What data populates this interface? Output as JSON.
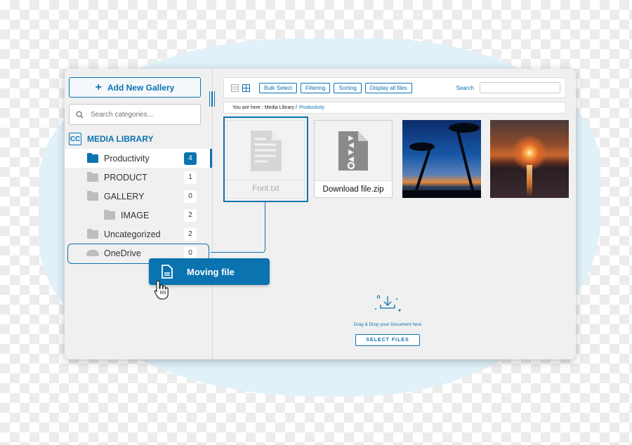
{
  "sidebar": {
    "add_gallery_label": "Add New Gallery",
    "search_placeholder": "Search categories...",
    "library_title": "MEDIA LIBRARY",
    "items": [
      {
        "label": "Productivity",
        "count": "4",
        "active": true,
        "icon": "folder-icon"
      },
      {
        "label": "PRODUCT",
        "count": "1",
        "icon": "folder-icon"
      },
      {
        "label": "GALLERY",
        "count": "0",
        "icon": "folder-icon"
      },
      {
        "label": "IMAGE",
        "count": "2",
        "icon": "folder-icon",
        "indent": 1
      },
      {
        "label": "Uncategorized",
        "count": "2",
        "icon": "folder-icon"
      },
      {
        "label": "OneDrive",
        "count": "0",
        "icon": "cloud-icon",
        "drop_target": true
      }
    ]
  },
  "toolbar": {
    "buttons": [
      "Bulk Select",
      "Filtering",
      "Sorting",
      "Display all files"
    ],
    "search_label": "Search",
    "search_value": ""
  },
  "breadcrumb": {
    "prefix": "You are here :",
    "path": "Media Library /",
    "current": "Productivity"
  },
  "files": [
    {
      "name": "Font.txt",
      "type": "text-file-icon",
      "selected": true
    },
    {
      "name": "Download file.zip",
      "type": "zip-file-icon"
    },
    {
      "name": "",
      "type": "photo-palm-beach"
    },
    {
      "name": "",
      "type": "photo-sunset-sea"
    }
  ],
  "drop_zone": {
    "text": "Drag & Drop your Document here",
    "button_label": "SELECT FILES"
  },
  "drag": {
    "label": "Moving file"
  },
  "colors": {
    "accent": "#0a73b0",
    "panel": "#f0f0f0",
    "backdrop_blob": "#e1f1f9"
  }
}
